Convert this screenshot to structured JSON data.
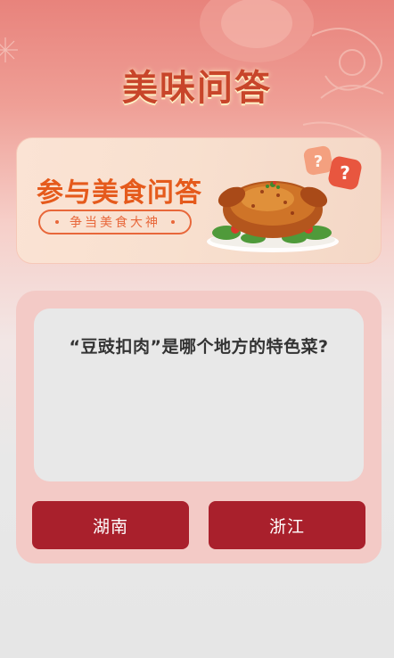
{
  "header": {
    "title": "美味问答"
  },
  "banner": {
    "title": "参与美食问答",
    "subtitle": "争当美食大神",
    "image": "roast-chicken-dish"
  },
  "quiz": {
    "question": "“豆豉扣肉”是哪个地方的特色菜?",
    "options": [
      "湖南",
      "浙江"
    ]
  },
  "colors": {
    "accent": "#a9202c",
    "title": "#c8452a",
    "banner_text": "#e55a1c",
    "card_bg": "#f3cac6",
    "question_bg": "#e8e8e8"
  }
}
